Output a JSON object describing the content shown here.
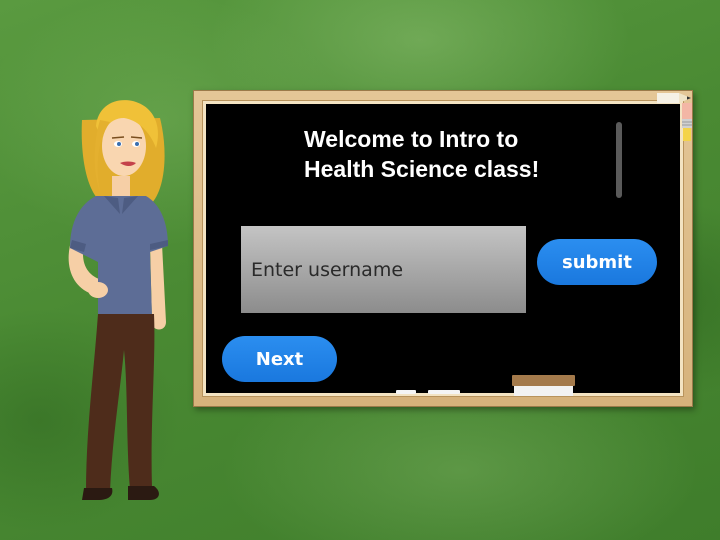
{
  "board": {
    "title_line1": "Welcome to Intro to",
    "title_line2": "Health Science class!"
  },
  "form": {
    "username_placeholder": "Enter username",
    "username_value": "",
    "submit_label": "submit"
  },
  "navigation": {
    "next_label": "Next"
  },
  "colors": {
    "background_green": "#4c8a35",
    "board_black": "#000000",
    "button_blue": "#1f82e8",
    "frame_wood": "#d9b680"
  },
  "icons": {
    "character": "teacher-character",
    "pencil": "pencil-icon",
    "eraser": "eraser-icon"
  }
}
